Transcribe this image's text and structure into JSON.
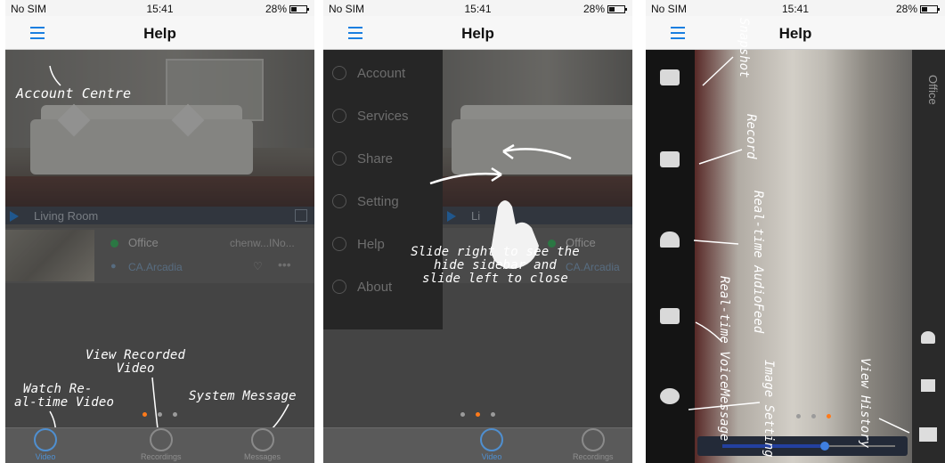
{
  "status": {
    "carrier": "No SIM",
    "time": "15:41",
    "battery": "28%"
  },
  "nav": {
    "title": "Help"
  },
  "phone1": {
    "camera_name": "Living Room",
    "device": {
      "name": "Office",
      "owner": "chenw...INo...",
      "location": "CA.Arcadia"
    },
    "tabs": [
      "Video",
      "Recordings",
      "Messages"
    ],
    "annotations": {
      "account": "Account Centre",
      "recorded": [
        "View Recorded",
        "Video"
      ],
      "realtime": [
        "Watch Re-",
        "al-time Video"
      ],
      "message": "System Message"
    },
    "page_index": 0
  },
  "phone2": {
    "sidebar": [
      "Account",
      "Services",
      "Share",
      "Setting",
      "Help",
      "About"
    ],
    "camera_name": "Li",
    "device": {
      "name": "Office",
      "location": "CA.Arcadia"
    },
    "tabs": [
      "Video",
      "Recordings"
    ],
    "annotation": [
      "Slide right to see the",
      "hide sidebar and",
      "slide left to close"
    ],
    "page_index": 1
  },
  "phone3": {
    "right_label": "Office",
    "annotations": {
      "snapshot": "Snapshot",
      "record": "Record",
      "audio": [
        "Real-time Audio",
        "Feed"
      ],
      "voice": [
        "Real-time Voice",
        "Message"
      ],
      "image": "Image Setting",
      "history": "View History"
    },
    "page_index": 2
  },
  "pager_total": 3,
  "colors": {
    "accent": "#1a7fe0",
    "pager_active": "#ff7a1a",
    "online": "#2fb85a"
  }
}
